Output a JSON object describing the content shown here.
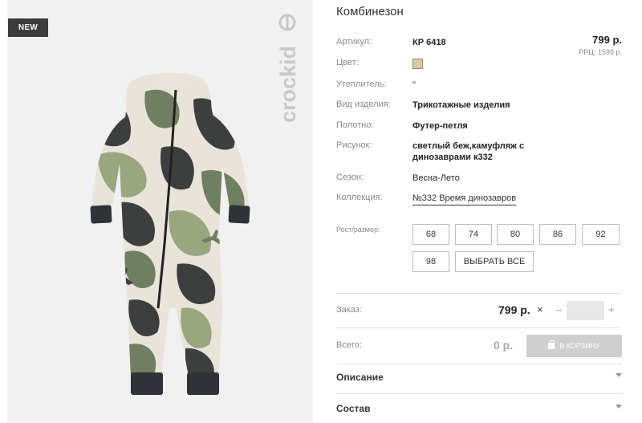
{
  "badge": "NEW",
  "brand": "crockid",
  "product": {
    "title": "Комбинезон",
    "price": "799 р.",
    "rrc": "РРЦ: 1599 р.",
    "specs": [
      {
        "label": "Артикул:",
        "value": "КР 6418"
      },
      {
        "label": "Цвет:",
        "value": ""
      },
      {
        "label": "Утеплитель:",
        "value": "\""
      },
      {
        "label": "Вид изделия:",
        "value": "Трикотажные изделия"
      },
      {
        "label": "Полотно:",
        "value": "Футер-петля"
      },
      {
        "label": "Рисунок:",
        "value_line1": "светлый беж,камуфляж с",
        "value_line2": "динозаврами к332"
      },
      {
        "label": "Сезон:",
        "value": "Весна-Лето"
      },
      {
        "label": "Коллекция:",
        "value": "№332 Время динозавров"
      }
    ],
    "color_swatch": "#dccaa0"
  },
  "sizes": {
    "label": "Рост/размер:",
    "options": [
      "68",
      "74",
      "80",
      "86",
      "92",
      "98"
    ],
    "select_all": "ВЫБРАТЬ ВСЕ"
  },
  "order": {
    "label": "Заказ:",
    "price": "799 р.",
    "times": "×",
    "minus": "–",
    "plus": "+",
    "qty_value": ""
  },
  "total": {
    "label": "Всего:",
    "value": "0 р.",
    "cart_button": "В КОРЗИНУ"
  },
  "accordions": [
    {
      "title": "Описание"
    },
    {
      "title": "Состав"
    }
  ],
  "colors": {
    "camo_light": "#e9e4da",
    "camo_green": "#6f7f5f",
    "camo_dark": "#3c3f3d",
    "camo_olive": "#98a77e",
    "cuff": "#2f3236"
  }
}
